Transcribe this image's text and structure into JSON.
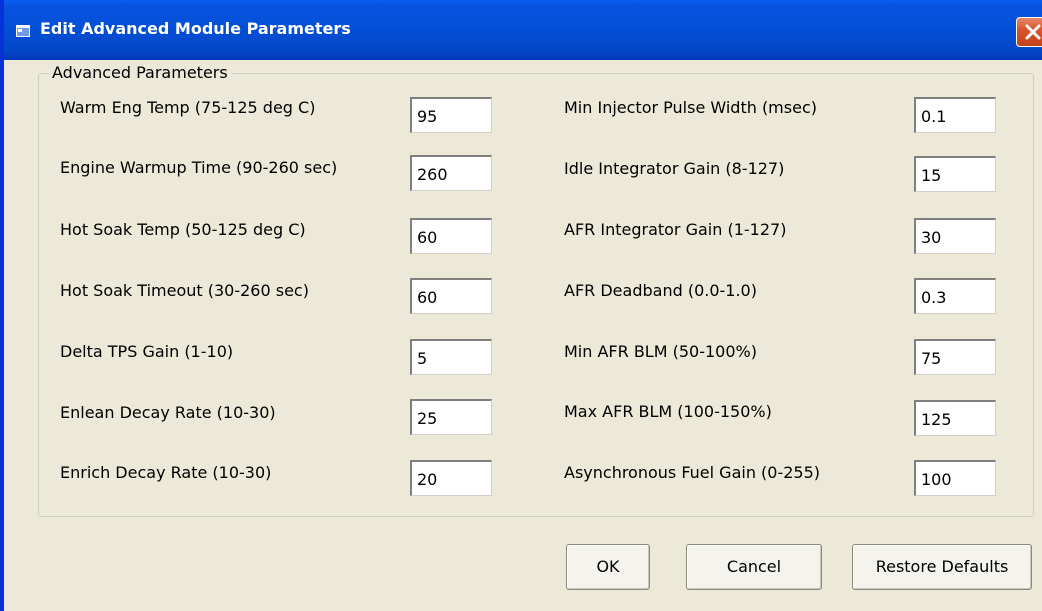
{
  "window": {
    "title": "Edit Advanced Module Parameters"
  },
  "group": {
    "label": "Advanced Parameters"
  },
  "left_params": [
    {
      "label": "Warm Eng Temp (75-125 deg C)",
      "value": "95"
    },
    {
      "label": "Engine Warmup Time (90-260 sec)",
      "value": "260"
    },
    {
      "label": "Hot Soak Temp (50-125 deg C)",
      "value": "60"
    },
    {
      "label": "Hot Soak Timeout (30-260 sec)",
      "value": "60"
    },
    {
      "label": "Delta TPS Gain (1-10)",
      "value": "5"
    },
    {
      "label": "Enlean Decay Rate (10-30)",
      "value": "25"
    },
    {
      "label": "Enrich Decay Rate (10-30)",
      "value": "20"
    }
  ],
  "right_params": [
    {
      "label": "Min Injector Pulse Width (msec)",
      "value": "0.1"
    },
    {
      "label": "Idle Integrator Gain (8-127)",
      "value": "15"
    },
    {
      "label": "AFR Integrator Gain (1-127)",
      "value": "30"
    },
    {
      "label": "AFR Deadband (0.0-1.0)",
      "value": "0.3"
    },
    {
      "label": "Min AFR BLM (50-100%)",
      "value": "75"
    },
    {
      "label": "Max AFR BLM (100-150%)",
      "value": "125"
    },
    {
      "label": "Asynchronous Fuel Gain (0-255)",
      "value": "100"
    }
  ],
  "buttons": {
    "ok": "OK",
    "cancel": "Cancel",
    "restore": "Restore Defaults"
  },
  "colors": {
    "titlebar": "#0450d8",
    "close_button": "#d9552c",
    "window_bg": "#ece9d8"
  }
}
